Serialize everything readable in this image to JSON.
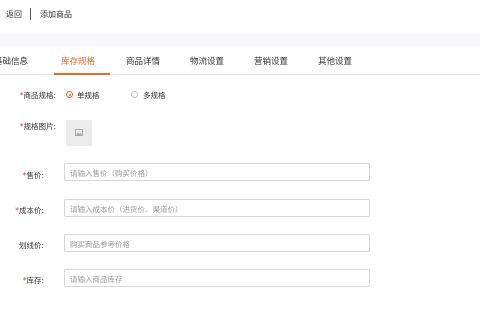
{
  "header": {
    "back_arrow": "‹",
    "back_label": "返回",
    "title": "添加商品"
  },
  "tabs": [
    {
      "label": "基础信息",
      "active": false
    },
    {
      "label": "库存规格",
      "active": true
    },
    {
      "label": "商品详情",
      "active": false
    },
    {
      "label": "物流设置",
      "active": false
    },
    {
      "label": "营销设置",
      "active": false
    },
    {
      "label": "其他设置",
      "active": false
    }
  ],
  "form": {
    "spec_type": {
      "required": "*",
      "label": "商品规格:",
      "options": [
        {
          "label": "单规格",
          "checked": true
        },
        {
          "label": "多规格",
          "checked": false
        }
      ]
    },
    "spec_image": {
      "required": "*",
      "label": "规格图片:",
      "icon": "image-placeholder-icon"
    },
    "price": {
      "required": "*",
      "label": "售价:",
      "placeholder": "请输入售价（购买价格）"
    },
    "cost": {
      "required": "*",
      "label": "成本价:",
      "placeholder": "请输入成本价（进货价、渠道价）"
    },
    "list_price": {
      "required": "",
      "label": "划线价:",
      "placeholder": "购买商品参考价格"
    },
    "stock": {
      "required": "*",
      "label": "库存:",
      "placeholder": "请输入商品库存"
    }
  },
  "colors": {
    "accent": "#e86a2a",
    "required": "#e53935",
    "border": "#d6d6d6",
    "band": "#f7f7f9"
  }
}
